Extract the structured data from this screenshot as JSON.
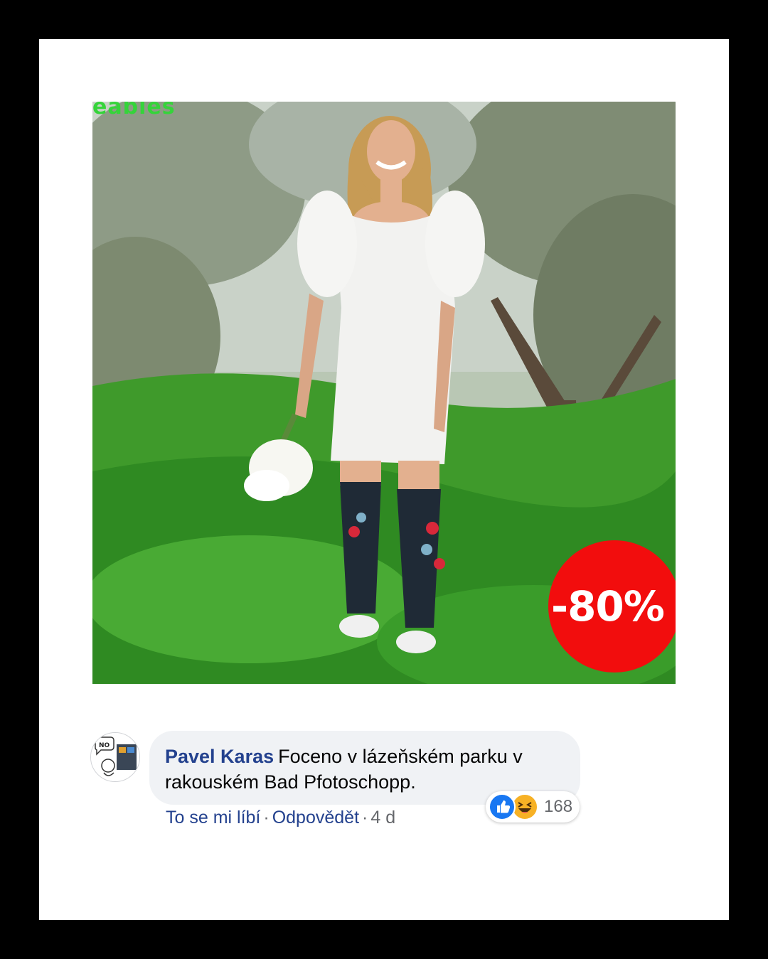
{
  "post": {
    "watermark_text": "eables",
    "discount_badge": "-80%",
    "badge_color": "#f20d0d"
  },
  "comment": {
    "author": "Pavel Karas",
    "text": "Foceno v lázeňském parku v rakouském Bad Pfotoschopp.",
    "avatar_label": "NO",
    "actions": {
      "like": "To se mi líbí",
      "reply": "Odpovědět",
      "time": "4 d"
    },
    "reactions": {
      "icons": [
        "like-icon",
        "haha-icon"
      ],
      "count": "168"
    }
  },
  "colors": {
    "author_link": "#23418e",
    "bubble_bg": "#f0f2f5",
    "like_blue": "#1877f2",
    "haha_yellow": "#f7b125"
  }
}
